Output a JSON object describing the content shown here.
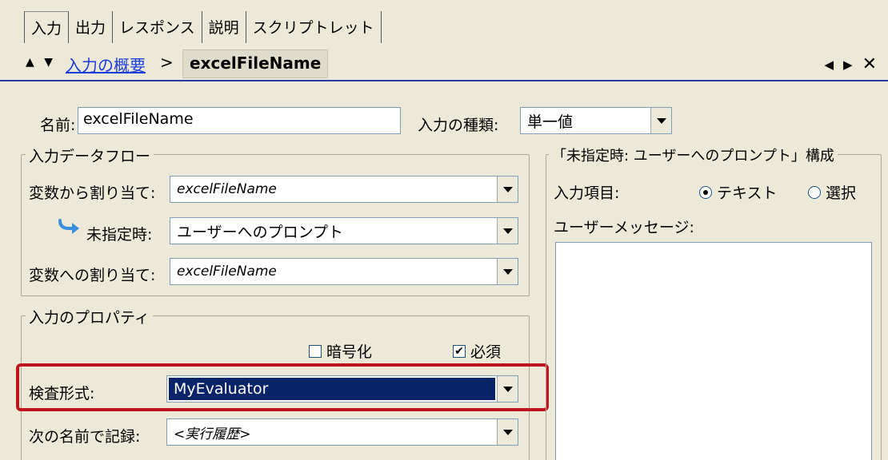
{
  "tabs": [
    "入力",
    "出力",
    "レスポンス",
    "説明",
    "スクリプトレット"
  ],
  "breadcrumb": {
    "up_down": "▲ ▼",
    "parent": "入力の概要",
    "separator": ">",
    "current": "excelFileName"
  },
  "nav": {
    "prev": "◀",
    "next": "▶",
    "close": "✕"
  },
  "name_field": {
    "label": "名前:",
    "value": "excelFileName"
  },
  "input_type": {
    "label": "入力の種類:",
    "value": "単一値"
  },
  "input_dataflow": {
    "title": "入力データフロー",
    "assign_from_var": {
      "label": "変数から割り当て:",
      "value": "excelFileName"
    },
    "when_unspecified": {
      "label": "未指定時:",
      "value": "ユーザーへのプロンプト"
    },
    "assign_to_var": {
      "label": "変数への割り当て:",
      "value": "excelFileName"
    }
  },
  "input_properties": {
    "title": "入力のプロパティ",
    "encrypt": {
      "label": "暗号化",
      "checked": false
    },
    "required": {
      "label": "必須",
      "checked": true,
      "mark": "✔"
    },
    "validation": {
      "label": "検査形式:",
      "value": "MyEvaluator"
    },
    "record_as": {
      "label": "次の名前で記録:",
      "value": "<実行履歴>"
    }
  },
  "prompt_config": {
    "title": "「未指定時: ユーザーへのプロンプト」構成",
    "input_item_label": "入力項目:",
    "option_text": {
      "label": "テキスト",
      "selected": true
    },
    "option_select": {
      "label": "選択",
      "selected": false
    },
    "user_message_label": "ユーザーメッセージ:",
    "user_message_value": ""
  },
  "colors": {
    "highlight": "#c0141c",
    "link": "#1a3cdc",
    "selection": "#0a246a"
  },
  "icons": {
    "when_unspecified": "curved-arrow-icon"
  }
}
